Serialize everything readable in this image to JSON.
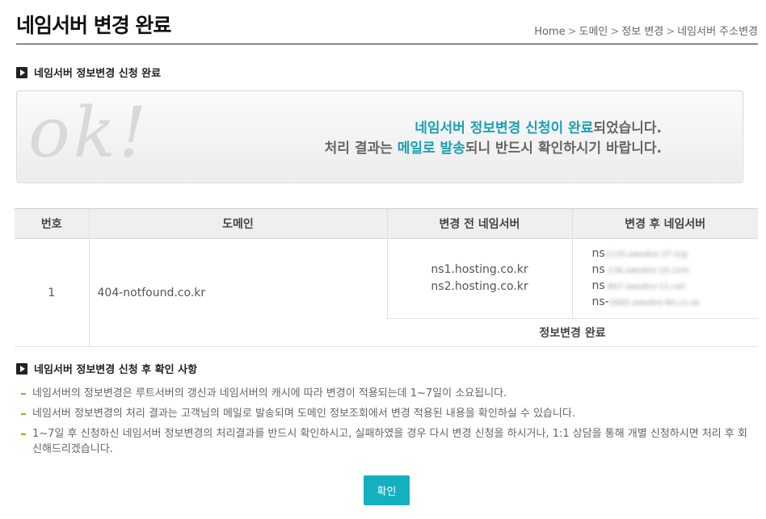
{
  "header": {
    "title": "네임서버 변경 완료",
    "breadcrumb": [
      "Home",
      "도메인",
      "정보 변경",
      "네임서버 주소변경"
    ],
    "breadcrumb_separator": ">"
  },
  "section1": {
    "title": "네임서버 정보변경 신청 완료",
    "icon": "arrow-bullet-icon"
  },
  "ok_banner": {
    "graphic": "ok!",
    "line1": {
      "hl": "네임서버 정보변경 신청이 완료",
      "rest": "되었습니다."
    },
    "line2": {
      "pre": "처리 결과는 ",
      "hl": "메일로 발송",
      "rest": "되니 반드시 확인하시기 바랍니다."
    },
    "highlight_color": "#1aa1b3"
  },
  "table": {
    "headers": [
      "번호",
      "도메인",
      "변경 전 네임서버",
      "변경 후 네임서버"
    ],
    "row": {
      "num": "1",
      "domain": "404-notfound.co.kr",
      "before": [
        "ns1.hosting.co.kr",
        "ns2.hosting.co.kr"
      ],
      "after": [
        {
          "prefix": "ns",
          "blurred": "1120.awsdns-37.org"
        },
        {
          "prefix": "ns",
          "blurred": "-136.awsdns-16.com"
        },
        {
          "prefix": "ns",
          "blurred": "-807.awsdns-11.net"
        },
        {
          "prefix": "ns-",
          "blurred": "2000.awsdns-60.co.uk"
        }
      ],
      "status": "정보변경 완료"
    }
  },
  "section2": {
    "title": "네임서버 정보변경 신청 후 확인 사항",
    "icon": "arrow-bullet-icon"
  },
  "notes": [
    "네임서버의 정보변경은 루트서버의 갱신과 네임서버의 캐시에 따라 변경이 적용되는데 1~7일이 소요됩니다.",
    "네임서버 정보변경의 처리 결과는 고객님의 메일로 발송되며 도메인 정보조회에서 변경 적용된 내용을 확인하실 수 있습니다.",
    "1~7일 후 신청하신 네임서버 정보변경의 처리결과를 반드시 확인하시고, 실패하였을 경우 다시 변경 신청을 하시거나, 1:1 상담을 통해 개별 신청하시면 처리 후 회신해드리겠습니다."
  ],
  "button": {
    "label": "확인",
    "color": "#14b0c0"
  }
}
